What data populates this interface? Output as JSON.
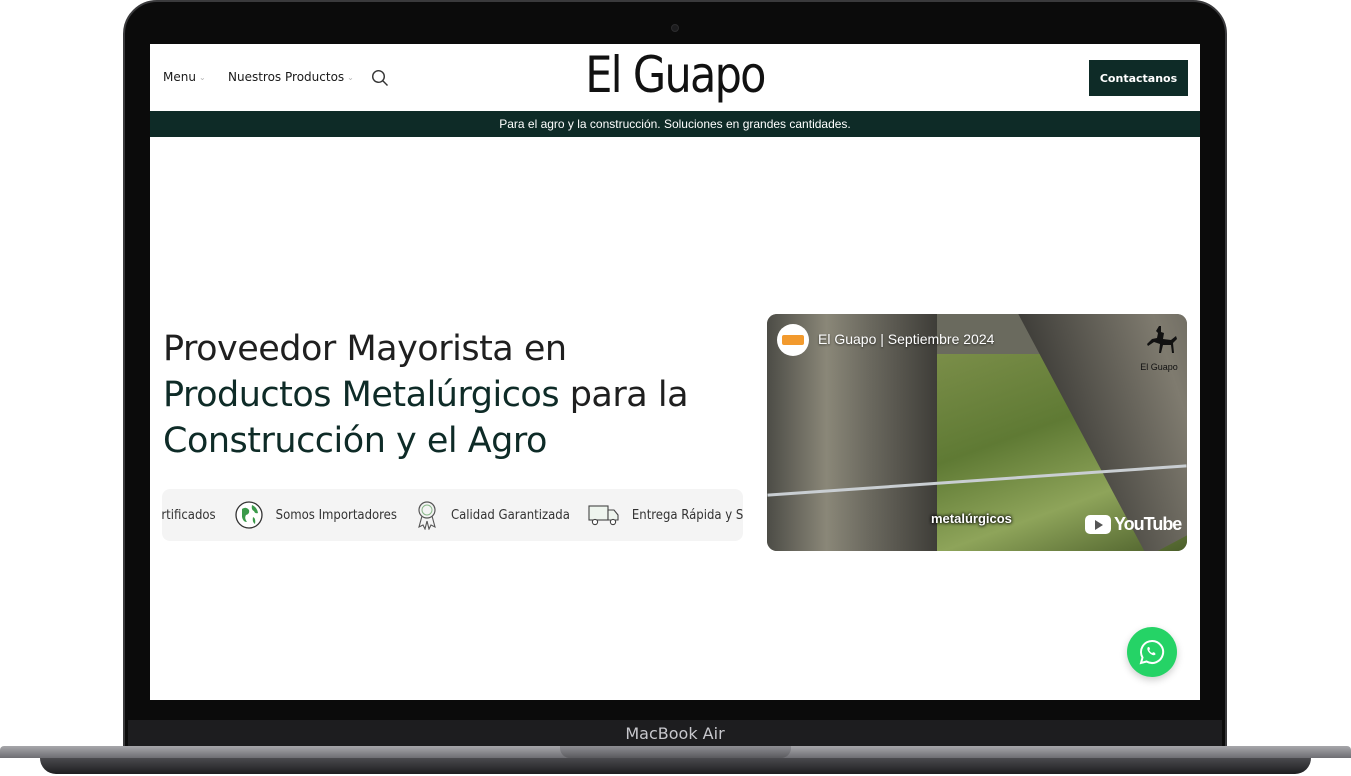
{
  "device": {
    "label": "MacBook Air"
  },
  "nav": {
    "menu_label": "Menu",
    "products_label": "Nuestros Productos",
    "logo": "El Guapo",
    "contact_label": "Contactanos"
  },
  "banner": {
    "text": "Para el agro y la construcción. Soluciones en grandes cantidades."
  },
  "hero": {
    "line1": "Proveedor Mayorista en",
    "line2_accent": "Productos Metalúrgicos",
    "line2_rest": " para la",
    "line3_accent": "Construcción y el Agro"
  },
  "features": [
    {
      "label": "Certificados",
      "icon": "certificate-icon"
    },
    {
      "label": "Somos Importadores",
      "icon": "globe-icon"
    },
    {
      "label": "Calidad Garantizada",
      "icon": "award-ribbon-icon"
    },
    {
      "label": "Entrega Rápida y Segura",
      "icon": "truck-icon"
    }
  ],
  "video": {
    "title": "El Guapo | Septiembre 2024",
    "caption": "metalúrgicos",
    "youtube_label": "YouTube",
    "watermark": "El Guapo"
  },
  "colors": {
    "brand": "#0e2b27",
    "whatsapp": "#25d366"
  }
}
